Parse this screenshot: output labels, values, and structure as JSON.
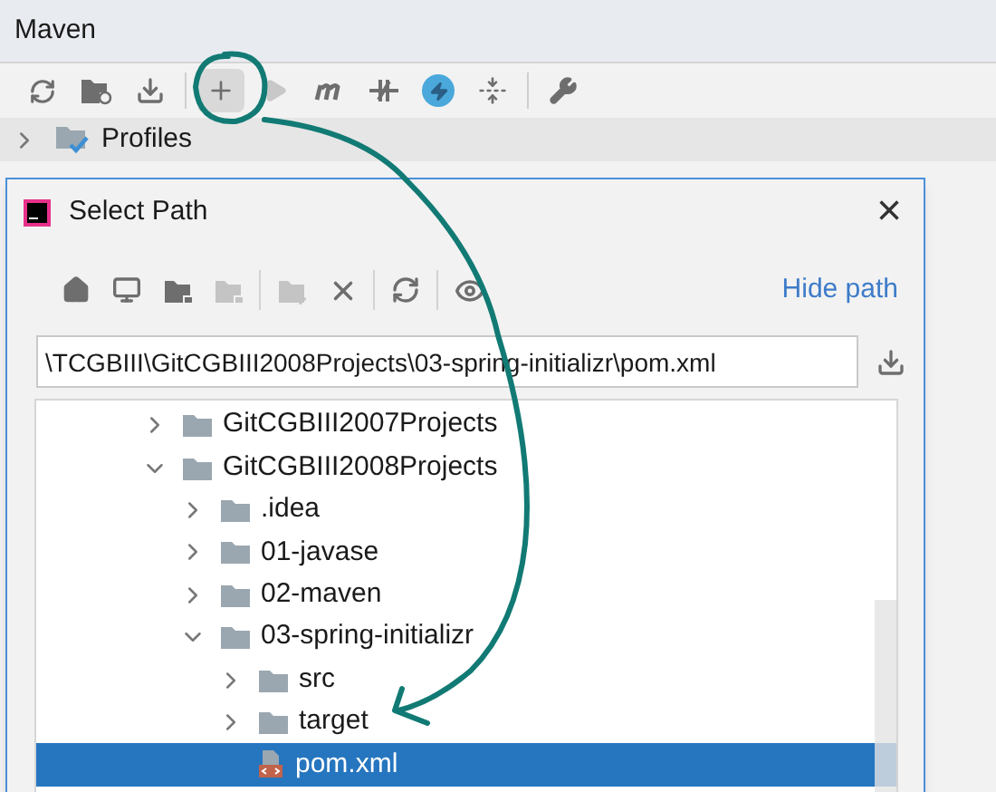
{
  "panel": {
    "title": "Maven",
    "toolbar": [
      {
        "disabled": false,
        "highlighted": false
      },
      {
        "disabled": false,
        "highlighted": false
      },
      {
        "disabled": false,
        "highlighted": false
      },
      {
        "disabled": false,
        "highlighted": true
      },
      {
        "disabled": true,
        "highlighted": false
      },
      {
        "disabled": false,
        "highlighted": false
      },
      {
        "disabled": false,
        "highlighted": false
      },
      {
        "disabled": false,
        "highlighted": false
      },
      {
        "disabled": false,
        "highlighted": false
      },
      {
        "disabled": false,
        "highlighted": false
      }
    ],
    "tree": [
      {
        "label": "Profiles",
        "expanded": false
      }
    ]
  },
  "dialog": {
    "title": "Select Path",
    "close": "×",
    "toolbar": [
      {
        "disabled": false
      },
      {
        "disabled": false
      },
      {
        "disabled": false
      },
      {
        "disabled": true
      },
      {
        "disabled": true
      },
      {
        "disabled": false
      },
      {
        "disabled": false
      },
      {
        "disabled": false
      }
    ],
    "hide_path_link": "Hide path",
    "path": "\\TCGBIII\\GitCGBIII2008Projects\\03-spring-initializr\\pom.xml",
    "tree": [
      {
        "label": "GitCGBIII2007Projects",
        "kind": "folder",
        "expanded": false,
        "selected": false
      },
      {
        "label": "GitCGBIII2008Projects",
        "kind": "folder",
        "expanded": true,
        "selected": false,
        "children": [
          {
            "label": ".idea",
            "kind": "folder",
            "expanded": false,
            "selected": false
          },
          {
            "label": "01-javase",
            "kind": "folder",
            "expanded": false,
            "selected": false
          },
          {
            "label": "02-maven",
            "kind": "folder",
            "expanded": false,
            "selected": false
          },
          {
            "label": "03-spring-initializr",
            "kind": "folder",
            "expanded": true,
            "selected": false,
            "children": [
              {
                "label": "src",
                "kind": "folder",
                "expanded": false,
                "selected": false
              },
              {
                "label": "target",
                "kind": "folder",
                "expanded": false,
                "selected": false
              },
              {
                "label": "pom.xml",
                "kind": "file",
                "selected": true
              }
            ]
          }
        ]
      }
    ]
  }
}
